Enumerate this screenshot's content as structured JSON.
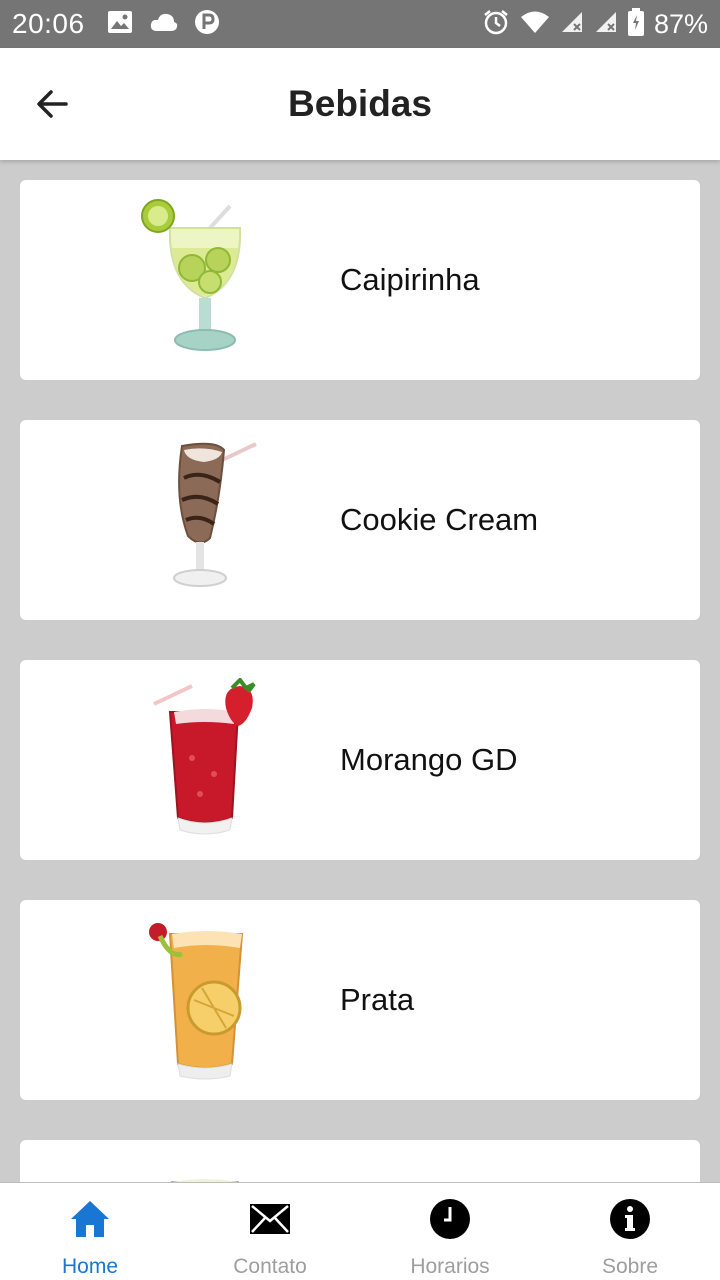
{
  "status_bar": {
    "time": "20:06",
    "battery": "87%",
    "icons": [
      "image-icon",
      "cloud-icon",
      "p-icon",
      "alarm-icon",
      "wifi-icon",
      "signal-icon",
      "signal-icon",
      "battery-icon"
    ]
  },
  "app_bar": {
    "title": "Bebidas",
    "back_icon": "arrow-left-icon"
  },
  "drinks": [
    {
      "name": "Caipirinha"
    },
    {
      "name": "Cookie Cream"
    },
    {
      "name": "Morango GD"
    },
    {
      "name": "Prata"
    }
  ],
  "bottom_nav": {
    "active": "Home",
    "active_color": "#1976d2",
    "items": [
      {
        "label": "Home",
        "icon": "home-icon"
      },
      {
        "label": "Contato",
        "icon": "mail-icon"
      },
      {
        "label": "Horarios",
        "icon": "clock-icon"
      },
      {
        "label": "Sobre",
        "icon": "info-icon"
      }
    ]
  }
}
